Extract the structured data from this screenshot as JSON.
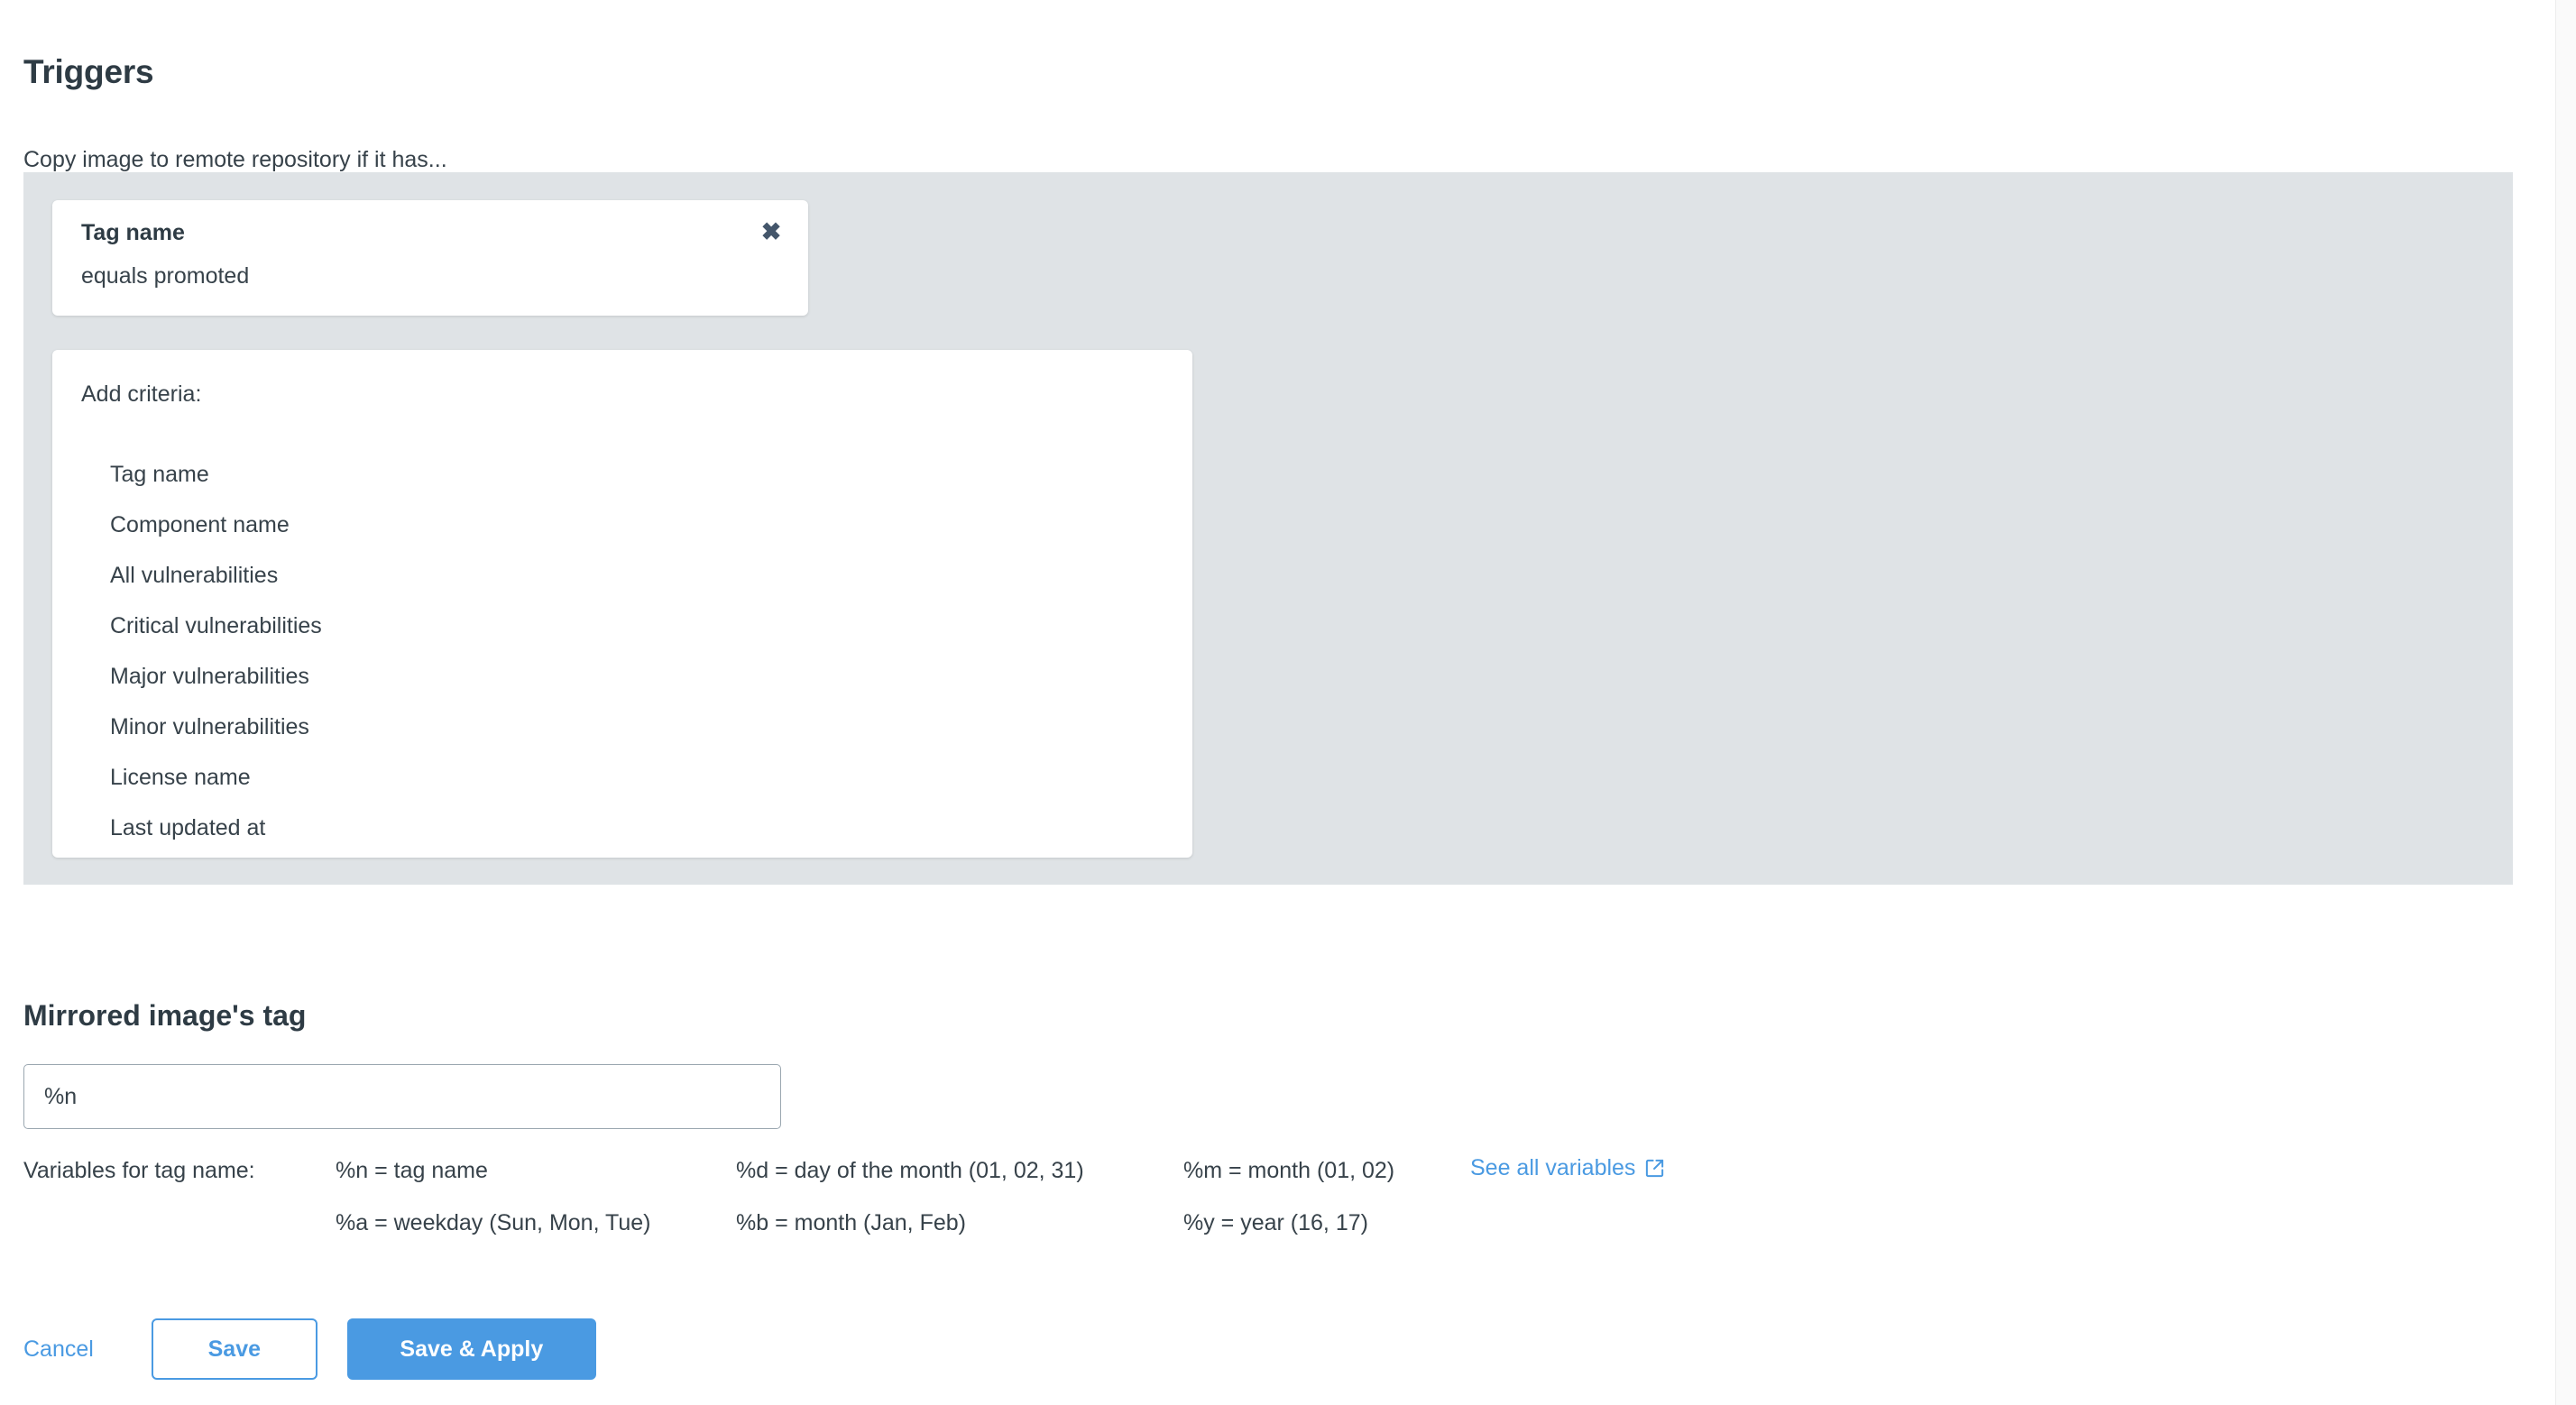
{
  "triggers": {
    "title": "Triggers",
    "subtitle": "Copy image to remote repository if it has...",
    "selected_criterion": {
      "name": "Tag name",
      "condition": "equals promoted",
      "remove_glyph": "✖"
    },
    "add_criteria": {
      "label": "Add criteria:",
      "options": [
        "Tag name",
        "Component name",
        "All vulnerabilities",
        "Critical vulnerabilities",
        "Major vulnerabilities",
        "Minor vulnerabilities",
        "License name",
        "Last updated at"
      ]
    }
  },
  "mirrored_tag": {
    "title": "Mirrored image's tag",
    "input_value": "%n",
    "input_placeholder": "",
    "variables": {
      "label": "Variables for tag name:",
      "rows": [
        {
          "c1": "%n = tag name",
          "c2": "%d = day of the month (01, 02, 31)",
          "c3": "%m = month (01, 02)"
        },
        {
          "c1": "%a = weekday (Sun, Mon, Tue)",
          "c2": "%b = month (Jan, Feb)",
          "c3": "%y = year (16, 17)"
        }
      ],
      "link_text": "See all variables"
    }
  },
  "actions": {
    "cancel": "Cancel",
    "save": "Save",
    "save_apply": "Save & Apply"
  },
  "colors": {
    "accent_blue": "#4a9ae2",
    "panel_gray": "#dfe3e6",
    "text_dark": "#2e3b44",
    "text_body": "#37424a",
    "input_border": "#9aa7b0"
  }
}
